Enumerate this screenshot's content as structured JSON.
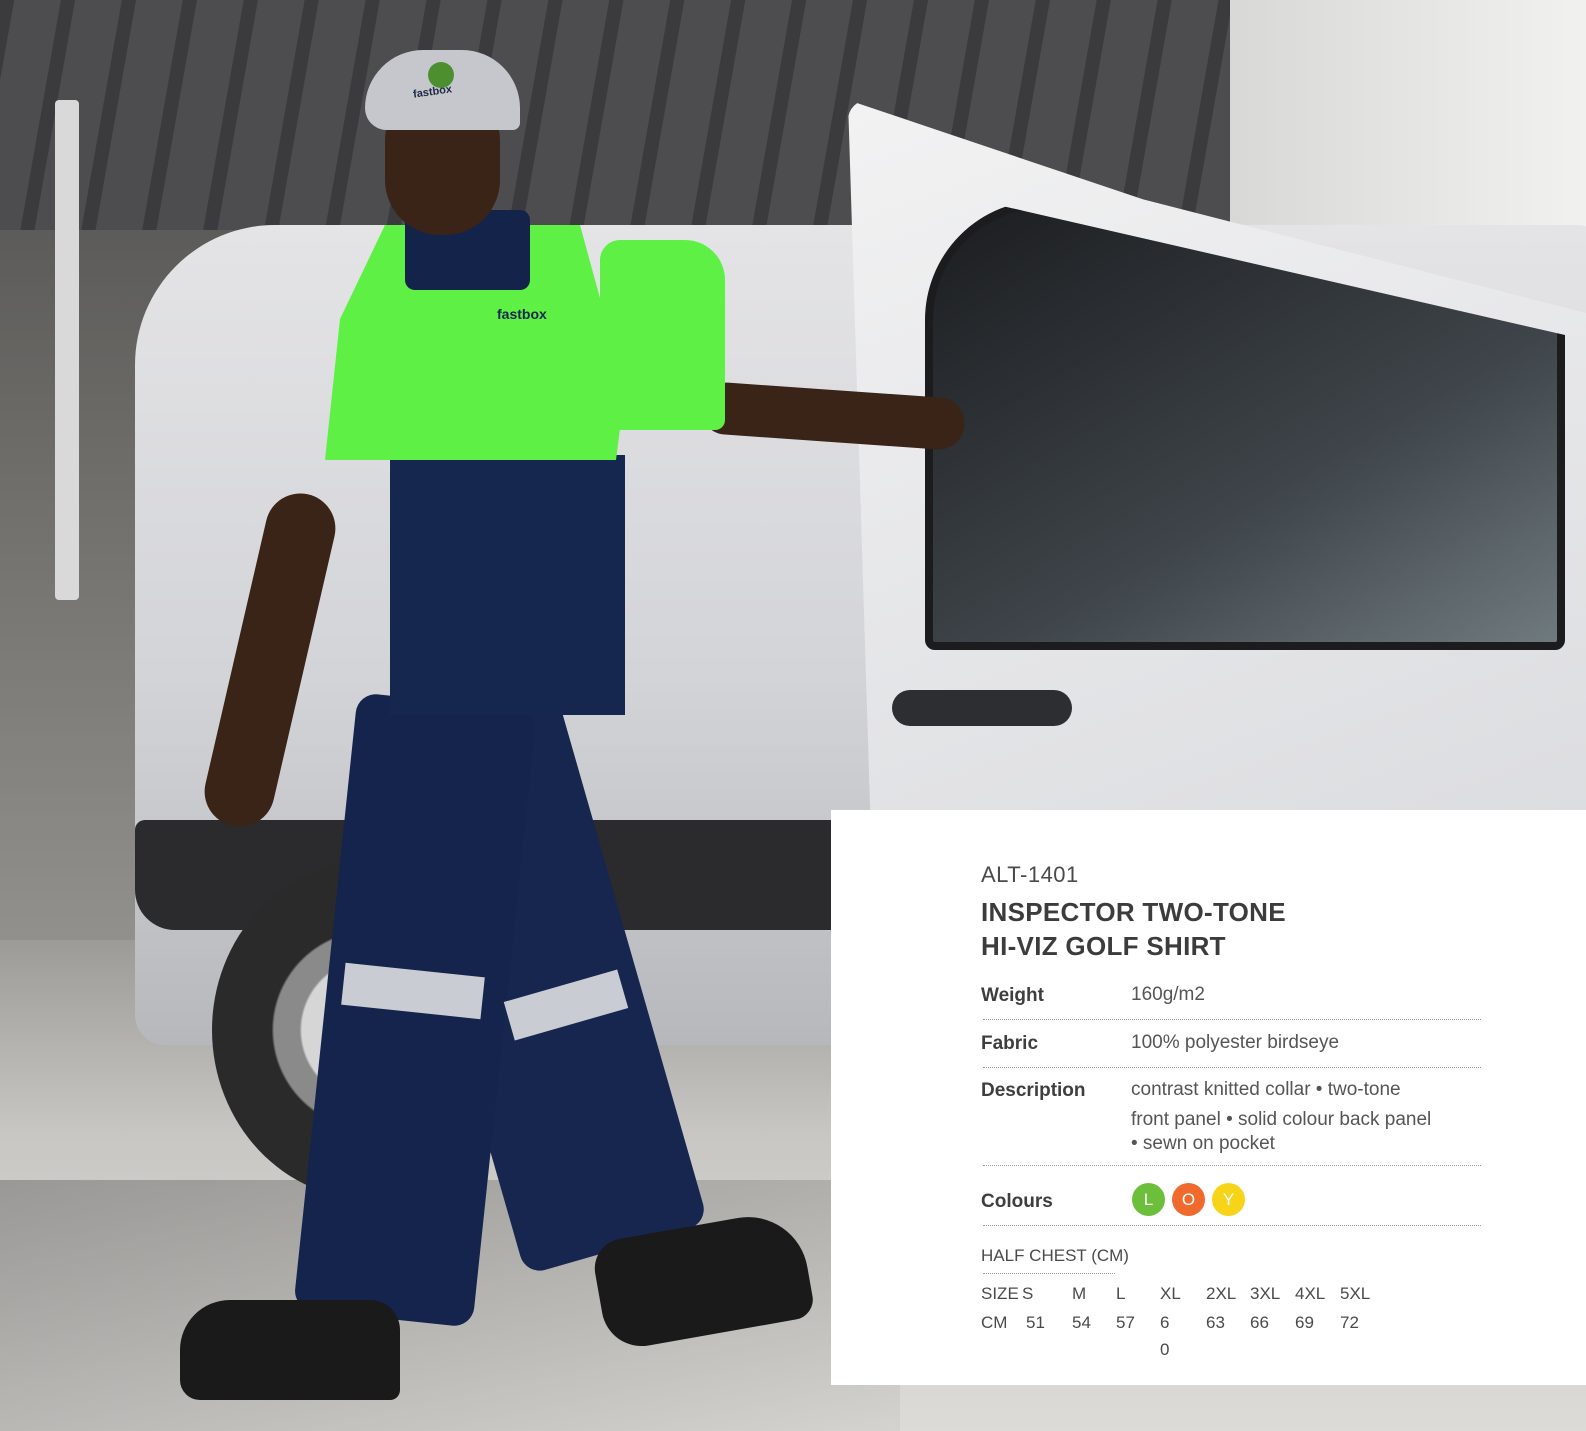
{
  "product": {
    "code": "ALT-1401",
    "title_line1": "INSPECTOR TWO-TONE",
    "title_line2": "HI-VIZ GOLF SHIRT"
  },
  "specs": {
    "weight_label": "Weight",
    "weight_value": "160g/m2",
    "fabric_label": "Fabric",
    "fabric_value": "100% polyester birdseye",
    "description_label": "Description",
    "description_line1": "contrast knitted collar • two-tone",
    "description_line2": "front panel • solid colour back panel",
    "description_line3": "• sewn on pocket",
    "colours_label": "Colours"
  },
  "colours": [
    {
      "code": "L",
      "color": "#6cbf3a"
    },
    {
      "code": "O",
      "color": "#ef6a2c"
    },
    {
      "code": "Y",
      "color": "#f7d418"
    }
  ],
  "size_chart": {
    "title": "HALF CHEST (CM)",
    "size_row_label": "SIZE",
    "cm_row_label": "CM",
    "sizes": [
      "S",
      "M",
      "L",
      "XL",
      "2XL",
      "3XL",
      "4XL",
      "5XL"
    ],
    "cm": [
      "51",
      "54",
      "57",
      "6",
      "63",
      "66",
      "69",
      "72"
    ],
    "cm_wrap": "0"
  },
  "photo": {
    "cap_logo_text": "fastbox",
    "shirt_logo_text": "fastbox"
  }
}
